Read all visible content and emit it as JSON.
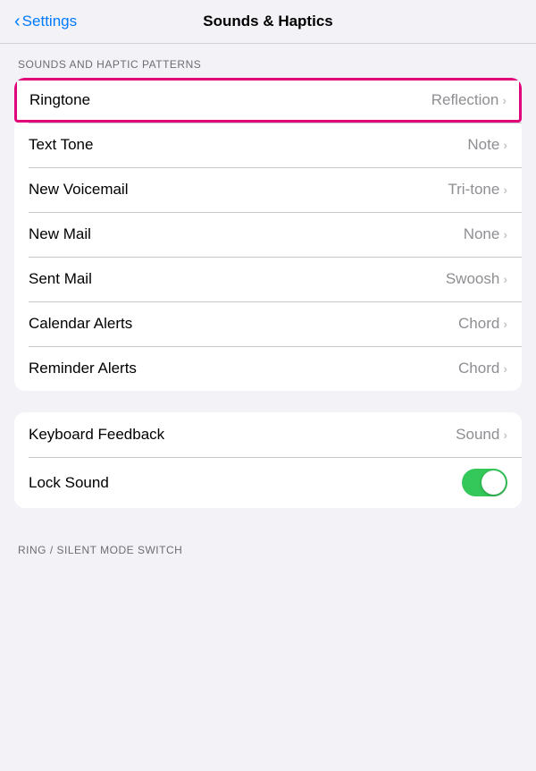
{
  "header": {
    "back_label": "Settings",
    "title": "Sounds & Haptics"
  },
  "section1": {
    "label": "SOUNDS AND HAPTIC PATTERNS",
    "rows": [
      {
        "id": "ringtone",
        "label": "Ringtone",
        "value": "Reflection",
        "highlighted": true
      },
      {
        "id": "text-tone",
        "label": "Text Tone",
        "value": "Note",
        "highlighted": false
      },
      {
        "id": "new-voicemail",
        "label": "New Voicemail",
        "value": "Tri-tone",
        "highlighted": false
      },
      {
        "id": "new-mail",
        "label": "New Mail",
        "value": "None",
        "highlighted": false
      },
      {
        "id": "sent-mail",
        "label": "Sent Mail",
        "value": "Swoosh",
        "highlighted": false
      },
      {
        "id": "calendar-alerts",
        "label": "Calendar Alerts",
        "value": "Chord",
        "highlighted": false
      },
      {
        "id": "reminder-alerts",
        "label": "Reminder Alerts",
        "value": "Chord",
        "highlighted": false
      }
    ]
  },
  "section2": {
    "rows": [
      {
        "id": "keyboard-feedback",
        "label": "Keyboard Feedback",
        "value": "Sound",
        "type": "nav"
      },
      {
        "id": "lock-sound",
        "label": "Lock Sound",
        "value": "",
        "type": "toggle",
        "enabled": true
      }
    ]
  },
  "section3": {
    "label": "RING / SILENT MODE SWITCH"
  }
}
